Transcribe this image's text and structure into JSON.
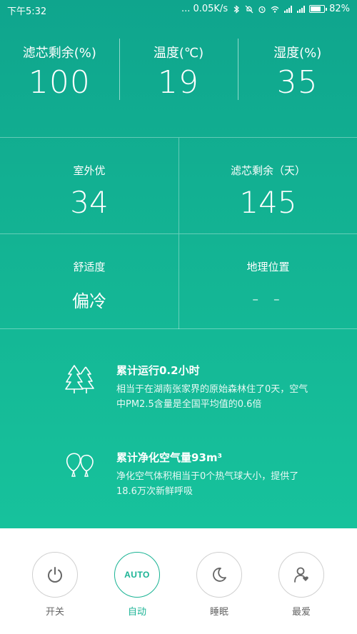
{
  "status_bar": {
    "time": "下午5:32",
    "network_speed": "... 0.05K/s",
    "battery": "82%",
    "battery_level": 0.82
  },
  "stats": [
    {
      "label": "滤芯剩余(%)",
      "value": "100"
    },
    {
      "label": "温度(℃)",
      "value": "19"
    },
    {
      "label": "湿度(%)",
      "value": "35"
    }
  ],
  "grid": {
    "outdoor": {
      "label": "室外优",
      "value": "34"
    },
    "filter_days": {
      "label": "滤芯剩余（天）",
      "value": "145"
    },
    "comfort": {
      "label": "舒适度",
      "value": "偏冷"
    },
    "location": {
      "label": "地理位置",
      "value": "- -"
    }
  },
  "info": [
    {
      "icon": "forest-icon",
      "title": "累计运行0.2小时",
      "desc": "相当于在湖南张家界的原始森林住了0天，空气中PM2.5含量是全国平均值的0.6倍"
    },
    {
      "icon": "balloon-icon",
      "title": "累计净化空气量93m³",
      "desc": "净化空气体积相当于0个热气球大小，提供了18.6万次新鲜呼吸"
    }
  ],
  "controls": [
    {
      "label": "开关",
      "icon": "power-icon"
    },
    {
      "label": "自动",
      "icon_text": "AUTO",
      "active": true
    },
    {
      "label": "睡眠",
      "icon": "moon-icon"
    },
    {
      "label": "最爱",
      "icon": "favorite-user-icon"
    }
  ],
  "colors": {
    "top_gradient_start": "#0fa58d",
    "top_gradient_end": "#17c29c",
    "accent": "#1ab394",
    "inactive_text": "#666666"
  }
}
